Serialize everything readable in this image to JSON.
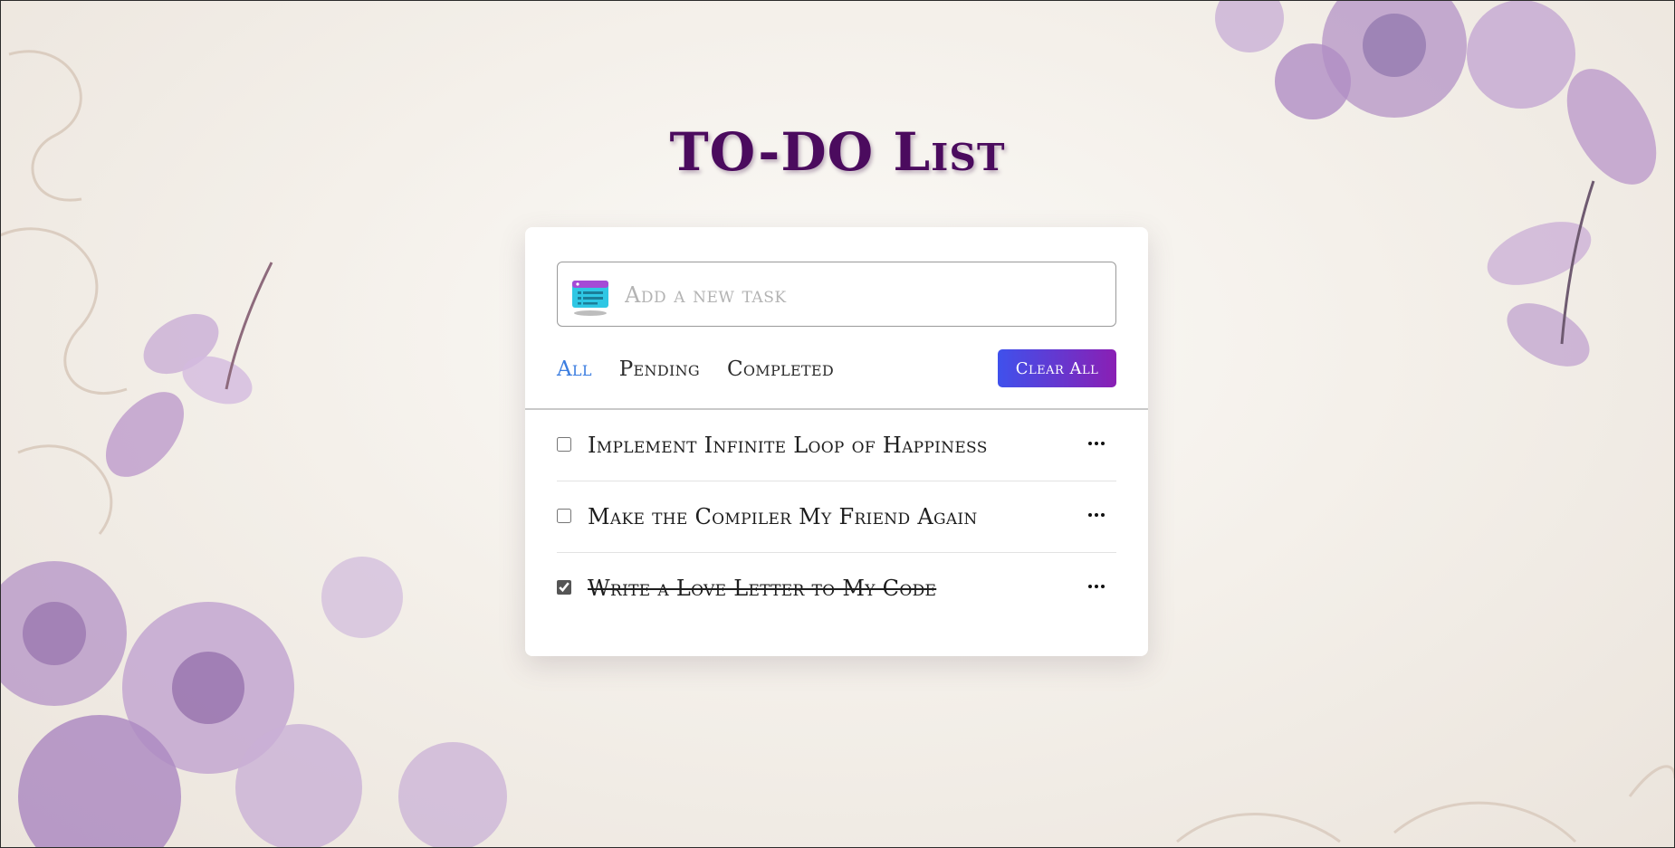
{
  "colors": {
    "title": "#4b0b5e",
    "accent_tab": "#3b7de0",
    "button_gradient_start": "#3f51ec",
    "button_gradient_end": "#8a1fb4",
    "flower": "#b899c8",
    "flower_dark": "#8e6aa4"
  },
  "page": {
    "title": "TO-DO List"
  },
  "input": {
    "placeholder": "Add a new task",
    "icon": "task-list-icon"
  },
  "filters": [
    {
      "label": "All",
      "active": true
    },
    {
      "label": "Pending",
      "active": false
    },
    {
      "label": "Completed",
      "active": false
    }
  ],
  "clear_button": {
    "label": "Clear All"
  },
  "tasks": [
    {
      "text": "Implement Infinite Loop of Happiness",
      "completed": false,
      "menu_icon": "ellipsis-icon"
    },
    {
      "text": "Make the Compiler My Friend Again",
      "completed": false,
      "menu_icon": "ellipsis-icon"
    },
    {
      "text": "Write a Love Letter to My Code",
      "completed": true,
      "menu_icon": "ellipsis-icon"
    }
  ]
}
